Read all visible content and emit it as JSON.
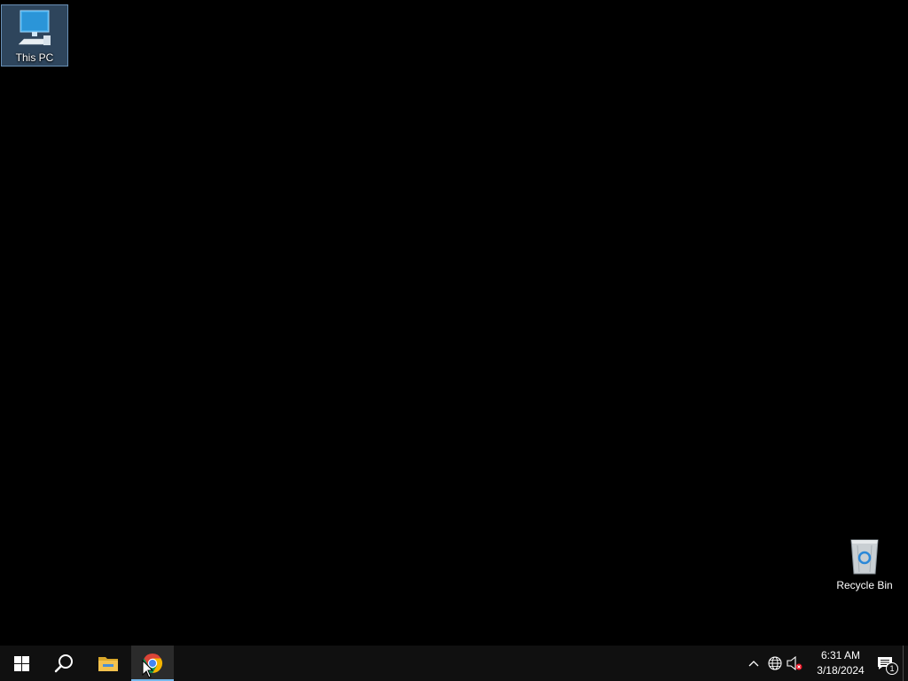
{
  "desktop": {
    "background_color": "#000000",
    "icons": [
      {
        "label": "This PC",
        "icon": "computer-icon",
        "selected": true
      },
      {
        "label": "Recycle Bin",
        "icon": "recycle-bin-icon",
        "selected": false
      }
    ]
  },
  "taskbar": {
    "background_color": "#101010",
    "start_icon": "windows-logo-icon",
    "search_icon": "search-icon",
    "pinned": [
      {
        "name": "File Explorer",
        "icon": "folder-icon",
        "active": false
      },
      {
        "name": "Google Chrome",
        "icon": "chrome-icon",
        "active": true
      }
    ],
    "tray": {
      "chevron_icon": "chevron-up-icon",
      "network_icon": "globe-network-icon",
      "volume_icon": "volume-muted-icon",
      "time": "6:31 AM",
      "date": "3/18/2024",
      "notifications_icon": "action-center-icon",
      "notification_count": "1"
    }
  },
  "colors": {
    "accent": "#76b9ed",
    "monitor_blue": "#3fa9e8",
    "folder_yellow": "#f2c14e"
  }
}
